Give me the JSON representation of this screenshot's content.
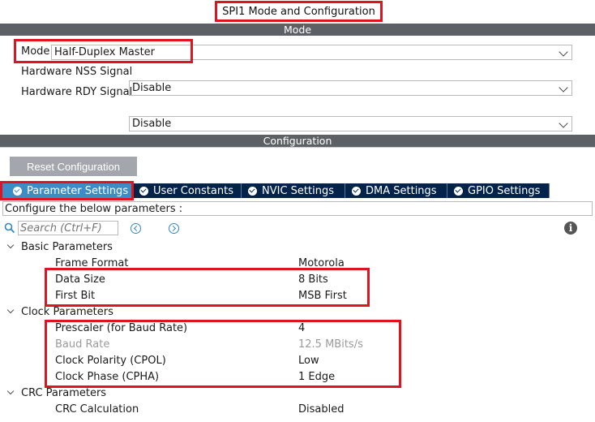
{
  "window_title": "SPI1 Mode and Configuration",
  "mode_section": {
    "header": "Mode",
    "rows": [
      {
        "label": "Mode",
        "value": "Half-Duplex Master"
      },
      {
        "label": "Hardware NSS Signal",
        "value": "Disable"
      },
      {
        "label": "Hardware RDY Signal",
        "value": "Disable"
      }
    ]
  },
  "config_section": {
    "header": "Configuration",
    "reset_label": "Reset Configuration",
    "tabs": [
      {
        "label": "Parameter Settings",
        "active": true
      },
      {
        "label": "User Constants",
        "active": false
      },
      {
        "label": "NVIC Settings",
        "active": false
      },
      {
        "label": "DMA Settings",
        "active": false
      },
      {
        "label": "GPIO Settings",
        "active": false
      }
    ],
    "instruction": "Configure the below parameters :",
    "search_placeholder": "Search (Ctrl+F)",
    "groups": [
      {
        "title": "Basic Parameters",
        "params": [
          {
            "name": "Frame Format",
            "value": "Motorola",
            "disabled": false
          },
          {
            "name": "Data Size",
            "value": "8 Bits",
            "disabled": false
          },
          {
            "name": "First Bit",
            "value": "MSB First",
            "disabled": false
          }
        ]
      },
      {
        "title": "Clock Parameters",
        "params": [
          {
            "name": "Prescaler (for Baud Rate)",
            "value": "4",
            "disabled": false
          },
          {
            "name": "Baud Rate",
            "value": "12.5 MBits/s",
            "disabled": true
          },
          {
            "name": "Clock Polarity (CPOL)",
            "value": "Low",
            "disabled": false
          },
          {
            "name": "Clock Phase (CPHA)",
            "value": "1 Edge",
            "disabled": false
          }
        ]
      },
      {
        "title": "CRC Parameters",
        "params": [
          {
            "name": "CRC Calculation",
            "value": "Disabled",
            "disabled": false
          }
        ]
      }
    ]
  },
  "colors": {
    "header_bar": "#5d6166",
    "tab_bg": "#03234b",
    "tab_active_bg": "#3c8dc5",
    "highlight_red": "#e0141e",
    "reset_button": "#a3a7ad"
  },
  "icons": {
    "search": "search-icon",
    "prev": "chevron-left-circle-icon",
    "next": "chevron-right-circle-icon",
    "info": "info-icon",
    "tab_check": "check-circle-icon"
  }
}
